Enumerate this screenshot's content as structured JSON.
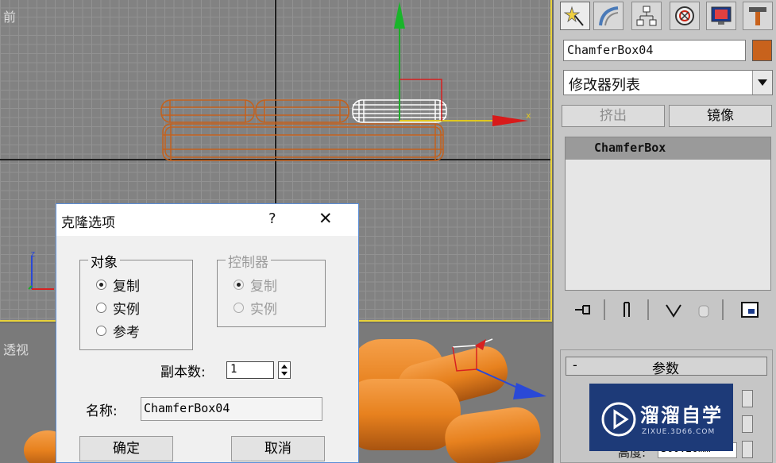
{
  "viewports": {
    "front_label": "前",
    "persp_label": "透视",
    "axis_x": "x",
    "axis_z": "z"
  },
  "command_panel": {
    "tabs": [
      "create-icon",
      "modify-icon",
      "hierarchy-icon",
      "motion-icon",
      "display-icon",
      "utilities-icon"
    ],
    "object_name": "ChamferBox04",
    "object_color": "#c8621c",
    "modifier_list": "修改器列表",
    "extrude_btn": "挤出",
    "mirror_btn": "镜像",
    "stack_item": "ChamferBox",
    "params_rollout": "参数",
    "params_collapse": "-",
    "height_label": "高度:",
    "height_value": "300.20mm"
  },
  "dialog": {
    "title": "克隆选项",
    "help": "?",
    "close": "✕",
    "object_group": "对象",
    "controller_group": "控制器",
    "obj_options": [
      "复制",
      "实例",
      "参考"
    ],
    "ctrl_options": [
      "复制",
      "实例"
    ],
    "copies_label": "副本数:",
    "copies_value": "1",
    "name_label": "名称:",
    "name_value": "ChamferBox04",
    "ok": "确定",
    "cancel": "取消"
  },
  "watermark": {
    "brand": "溜溜自学",
    "url": "ZIXUE.3D66.COM"
  }
}
